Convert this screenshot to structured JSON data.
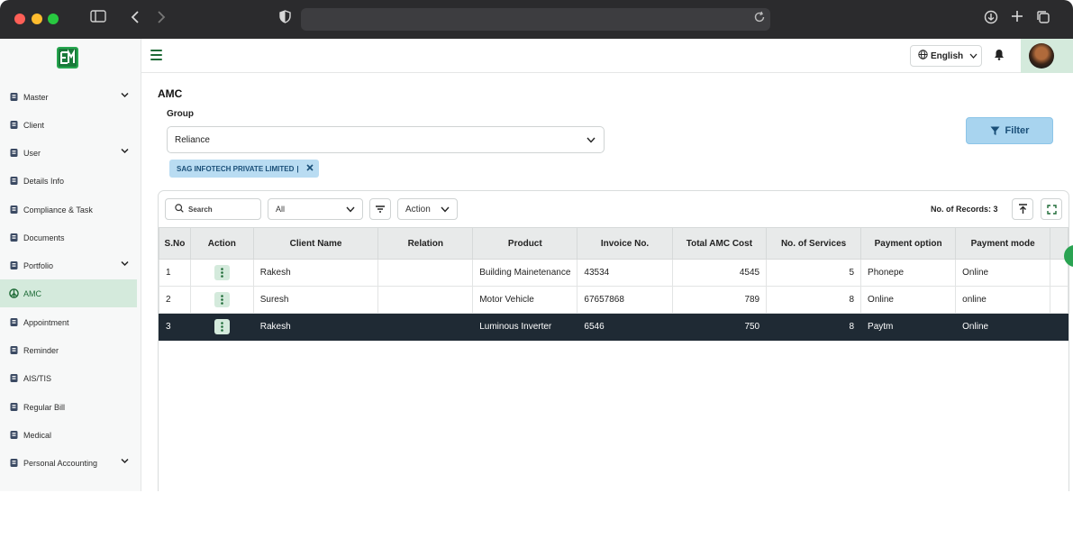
{
  "header": {
    "language_label": "English"
  },
  "sidebar": {
    "items": [
      {
        "label": "Master",
        "icon": "square-icon",
        "expandable": true
      },
      {
        "label": "Client",
        "icon": "clipboard-icon",
        "expandable": false
      },
      {
        "label": "User",
        "icon": "user-house-icon",
        "expandable": true
      },
      {
        "label": "Details Info",
        "icon": "contact-card-icon",
        "expandable": false
      },
      {
        "label": "Compliance & Task",
        "icon": "key-icon",
        "expandable": false
      },
      {
        "label": "Documents",
        "icon": "document-edit-icon",
        "expandable": false
      },
      {
        "label": "Portfolio",
        "icon": "user-icon",
        "expandable": true
      },
      {
        "label": "AMC",
        "icon": "peace-icon",
        "expandable": false,
        "active": true
      },
      {
        "label": "Appointment",
        "icon": "appointment-icon",
        "expandable": false
      },
      {
        "label": "Reminder",
        "icon": "reminder-icon",
        "expandable": false
      },
      {
        "label": "AIS/TIS",
        "icon": "tag-icon",
        "expandable": false
      },
      {
        "label": "Regular Bill",
        "icon": "user-check-icon",
        "expandable": false
      },
      {
        "label": "Medical",
        "icon": "user-check-icon",
        "expandable": false
      },
      {
        "label": "Personal Accounting",
        "icon": "user-check-icon",
        "expandable": true
      }
    ]
  },
  "main": {
    "title": "AMC",
    "group_label": "Group",
    "group_value": "Reliance",
    "chip_label": "SAG INFOTECH PRIVATE LIMITED",
    "chip_separator": "|",
    "filter_label": "Filter"
  },
  "grid": {
    "search_placeholder": "Search",
    "all_select_value": "All",
    "action_label": "Action",
    "records_text": "No. of Records: 3",
    "columns": [
      "S.No",
      "Action",
      "Client Name",
      "Relation",
      "Product",
      "Invoice No.",
      "Total AMC Cost",
      "No. of Services",
      "Payment option",
      "Payment mode"
    ],
    "rows": [
      {
        "sno": "1",
        "client": "Rakesh",
        "relation": "",
        "product": "Building Mainetenance",
        "invoice": "43534",
        "cost": "4545",
        "services": "5",
        "option": "Phonepe",
        "mode": "Online",
        "selected": false
      },
      {
        "sno": "2",
        "client": "Suresh",
        "relation": "",
        "product": "Motor Vehicle",
        "invoice": "67657868",
        "cost": "789",
        "services": "8",
        "option": "Online",
        "mode": "online",
        "selected": false
      },
      {
        "sno": "3",
        "client": "Rakesh",
        "relation": "",
        "product": "Luminous Inverter",
        "invoice": "6546",
        "cost": "750",
        "services": "8",
        "option": "Paytm",
        "mode": "Online",
        "selected": true
      }
    ]
  },
  "colors": {
    "accent_green": "#1e6b37",
    "active_bg": "#d4eadc",
    "filter_blue": "#a8d4ef",
    "selected_row": "#1f2a34"
  }
}
